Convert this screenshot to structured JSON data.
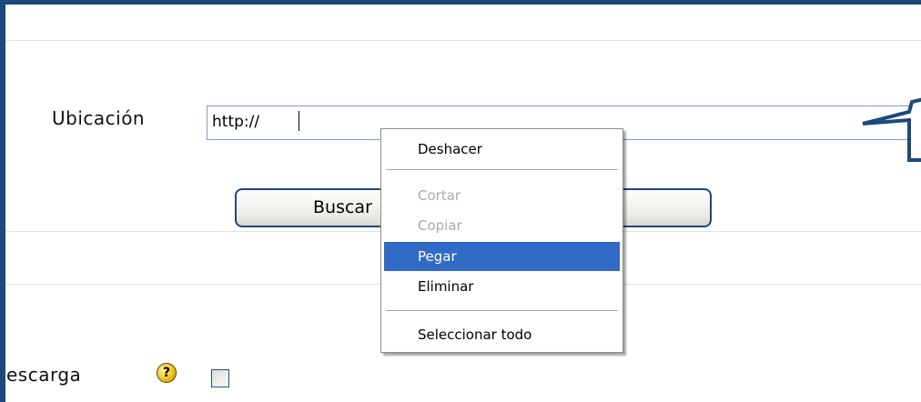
{
  "form": {
    "location_label": "Ubicación",
    "location_value": "http://",
    "search_button_label": "Buscar",
    "download_label": "escarga",
    "help_symbol": "?"
  },
  "context_menu": {
    "items": [
      {
        "label": "Deshacer",
        "enabled": true
      },
      {
        "label": "Cortar",
        "enabled": false
      },
      {
        "label": "Copiar",
        "enabled": false
      },
      {
        "label": "Pegar",
        "enabled": true,
        "highlighted": true
      },
      {
        "label": "Eliminar",
        "enabled": true
      },
      {
        "label": "Seleccionar todo",
        "enabled": true
      }
    ]
  },
  "colors": {
    "frame": "#1c4a7a",
    "menu_highlight": "#316ac5",
    "disabled_text": "#a9a9a9",
    "help_icon": "#f0c419"
  },
  "icons": {
    "help": "help-icon",
    "callout": "speech-callout-icon"
  }
}
